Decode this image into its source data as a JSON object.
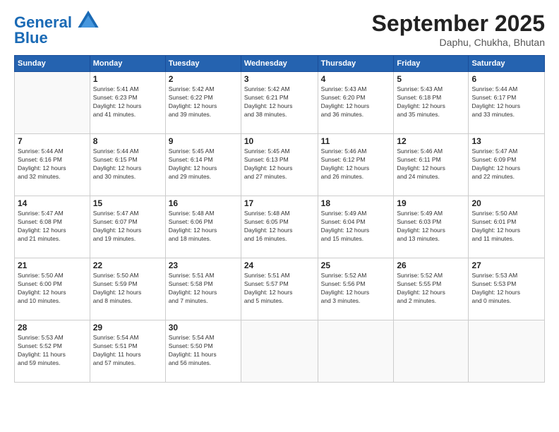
{
  "header": {
    "logo_general": "General",
    "logo_blue": "Blue",
    "month_title": "September 2025",
    "subtitle": "Daphu, Chukha, Bhutan"
  },
  "days_of_week": [
    "Sunday",
    "Monday",
    "Tuesday",
    "Wednesday",
    "Thursday",
    "Friday",
    "Saturday"
  ],
  "weeks": [
    [
      {
        "day": "",
        "info": ""
      },
      {
        "day": "1",
        "info": "Sunrise: 5:41 AM\nSunset: 6:23 PM\nDaylight: 12 hours\nand 41 minutes."
      },
      {
        "day": "2",
        "info": "Sunrise: 5:42 AM\nSunset: 6:22 PM\nDaylight: 12 hours\nand 39 minutes."
      },
      {
        "day": "3",
        "info": "Sunrise: 5:42 AM\nSunset: 6:21 PM\nDaylight: 12 hours\nand 38 minutes."
      },
      {
        "day": "4",
        "info": "Sunrise: 5:43 AM\nSunset: 6:20 PM\nDaylight: 12 hours\nand 36 minutes."
      },
      {
        "day": "5",
        "info": "Sunrise: 5:43 AM\nSunset: 6:18 PM\nDaylight: 12 hours\nand 35 minutes."
      },
      {
        "day": "6",
        "info": "Sunrise: 5:44 AM\nSunset: 6:17 PM\nDaylight: 12 hours\nand 33 minutes."
      }
    ],
    [
      {
        "day": "7",
        "info": "Sunrise: 5:44 AM\nSunset: 6:16 PM\nDaylight: 12 hours\nand 32 minutes."
      },
      {
        "day": "8",
        "info": "Sunrise: 5:44 AM\nSunset: 6:15 PM\nDaylight: 12 hours\nand 30 minutes."
      },
      {
        "day": "9",
        "info": "Sunrise: 5:45 AM\nSunset: 6:14 PM\nDaylight: 12 hours\nand 29 minutes."
      },
      {
        "day": "10",
        "info": "Sunrise: 5:45 AM\nSunset: 6:13 PM\nDaylight: 12 hours\nand 27 minutes."
      },
      {
        "day": "11",
        "info": "Sunrise: 5:46 AM\nSunset: 6:12 PM\nDaylight: 12 hours\nand 26 minutes."
      },
      {
        "day": "12",
        "info": "Sunrise: 5:46 AM\nSunset: 6:11 PM\nDaylight: 12 hours\nand 24 minutes."
      },
      {
        "day": "13",
        "info": "Sunrise: 5:47 AM\nSunset: 6:09 PM\nDaylight: 12 hours\nand 22 minutes."
      }
    ],
    [
      {
        "day": "14",
        "info": "Sunrise: 5:47 AM\nSunset: 6:08 PM\nDaylight: 12 hours\nand 21 minutes."
      },
      {
        "day": "15",
        "info": "Sunrise: 5:47 AM\nSunset: 6:07 PM\nDaylight: 12 hours\nand 19 minutes."
      },
      {
        "day": "16",
        "info": "Sunrise: 5:48 AM\nSunset: 6:06 PM\nDaylight: 12 hours\nand 18 minutes."
      },
      {
        "day": "17",
        "info": "Sunrise: 5:48 AM\nSunset: 6:05 PM\nDaylight: 12 hours\nand 16 minutes."
      },
      {
        "day": "18",
        "info": "Sunrise: 5:49 AM\nSunset: 6:04 PM\nDaylight: 12 hours\nand 15 minutes."
      },
      {
        "day": "19",
        "info": "Sunrise: 5:49 AM\nSunset: 6:03 PM\nDaylight: 12 hours\nand 13 minutes."
      },
      {
        "day": "20",
        "info": "Sunrise: 5:50 AM\nSunset: 6:01 PM\nDaylight: 12 hours\nand 11 minutes."
      }
    ],
    [
      {
        "day": "21",
        "info": "Sunrise: 5:50 AM\nSunset: 6:00 PM\nDaylight: 12 hours\nand 10 minutes."
      },
      {
        "day": "22",
        "info": "Sunrise: 5:50 AM\nSunset: 5:59 PM\nDaylight: 12 hours\nand 8 minutes."
      },
      {
        "day": "23",
        "info": "Sunrise: 5:51 AM\nSunset: 5:58 PM\nDaylight: 12 hours\nand 7 minutes."
      },
      {
        "day": "24",
        "info": "Sunrise: 5:51 AM\nSunset: 5:57 PM\nDaylight: 12 hours\nand 5 minutes."
      },
      {
        "day": "25",
        "info": "Sunrise: 5:52 AM\nSunset: 5:56 PM\nDaylight: 12 hours\nand 3 minutes."
      },
      {
        "day": "26",
        "info": "Sunrise: 5:52 AM\nSunset: 5:55 PM\nDaylight: 12 hours\nand 2 minutes."
      },
      {
        "day": "27",
        "info": "Sunrise: 5:53 AM\nSunset: 5:53 PM\nDaylight: 12 hours\nand 0 minutes."
      }
    ],
    [
      {
        "day": "28",
        "info": "Sunrise: 5:53 AM\nSunset: 5:52 PM\nDaylight: 11 hours\nand 59 minutes."
      },
      {
        "day": "29",
        "info": "Sunrise: 5:54 AM\nSunset: 5:51 PM\nDaylight: 11 hours\nand 57 minutes."
      },
      {
        "day": "30",
        "info": "Sunrise: 5:54 AM\nSunset: 5:50 PM\nDaylight: 11 hours\nand 56 minutes."
      },
      {
        "day": "",
        "info": ""
      },
      {
        "day": "",
        "info": ""
      },
      {
        "day": "",
        "info": ""
      },
      {
        "day": "",
        "info": ""
      }
    ]
  ]
}
